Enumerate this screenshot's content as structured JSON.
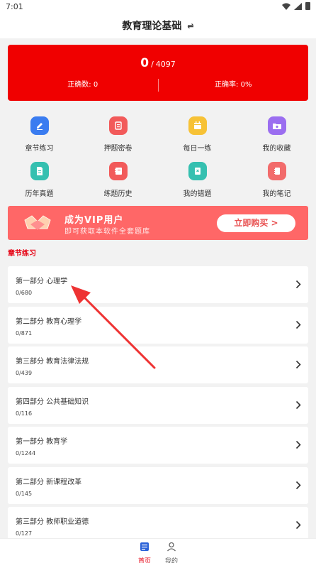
{
  "status_bar": {
    "time": "7:01"
  },
  "header": {
    "title": "教育理论基础",
    "switch_icon": "swap-icon"
  },
  "stats": {
    "done_count": "0",
    "separator": "/",
    "total_count": "4097",
    "correct_label": "正确数: 0",
    "rate_label": "正确率: 0%",
    "card_color": "#f00000"
  },
  "features": [
    {
      "label": "章节练习",
      "icon": "edit-icon",
      "color": "#3a7cf0"
    },
    {
      "label": "押题密卷",
      "icon": "paper-icon",
      "color": "#f25a5a"
    },
    {
      "label": "每日一练",
      "icon": "calendar-icon",
      "color": "#f7c236"
    },
    {
      "label": "我的收藏",
      "icon": "folder-star-icon",
      "color": "#9b6ef0"
    },
    {
      "label": "历年真题",
      "icon": "document-icon",
      "color": "#35c0b0"
    },
    {
      "label": "练题历史",
      "icon": "history-icon",
      "color": "#f25a5a"
    },
    {
      "label": "我的错题",
      "icon": "wrong-book-icon",
      "color": "#35c0b0"
    },
    {
      "label": "我的笔记",
      "icon": "notebook-icon",
      "color": "#f26b6b"
    }
  ],
  "vip": {
    "title": "成为VIP用户",
    "subtitle": "即可获取本软件全套题库",
    "button": "立即购买 >",
    "color": "#ff6767"
  },
  "section": {
    "title": "章节练习"
  },
  "chapters": [
    {
      "title": "第一部分 心理学",
      "progress": "0/680"
    },
    {
      "title": "第二部分 教育心理学",
      "progress": "0/871"
    },
    {
      "title": "第三部分 教育法律法规",
      "progress": "0/439"
    },
    {
      "title": "第四部分 公共基础知识",
      "progress": "0/116"
    },
    {
      "title": "第一部分 教育学",
      "progress": "0/1244"
    },
    {
      "title": "第二部分 新课程改革",
      "progress": "0/145"
    },
    {
      "title": "第三部分 教师职业道德",
      "progress": "0/127"
    }
  ],
  "bottom_nav": [
    {
      "label": "首页",
      "icon": "home-icon",
      "active": true
    },
    {
      "label": "我的",
      "icon": "profile-icon",
      "active": false
    }
  ],
  "accent_color": "#e60012"
}
